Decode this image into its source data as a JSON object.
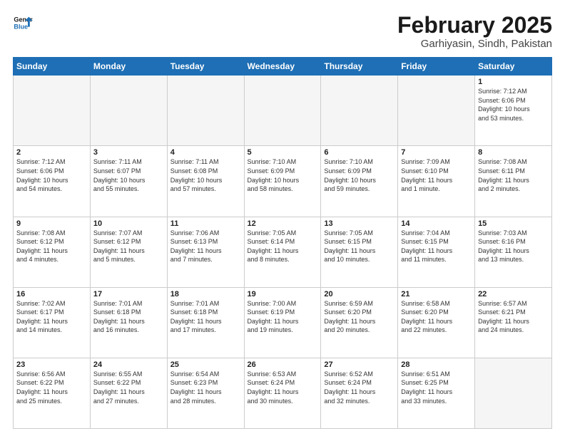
{
  "logo": {
    "line1": "General",
    "line2": "Blue"
  },
  "title": "February 2025",
  "subtitle": "Garhiyasin, Sindh, Pakistan",
  "weekdays": [
    "Sunday",
    "Monday",
    "Tuesday",
    "Wednesday",
    "Thursday",
    "Friday",
    "Saturday"
  ],
  "weeks": [
    [
      {
        "day": "",
        "info": ""
      },
      {
        "day": "",
        "info": ""
      },
      {
        "day": "",
        "info": ""
      },
      {
        "day": "",
        "info": ""
      },
      {
        "day": "",
        "info": ""
      },
      {
        "day": "",
        "info": ""
      },
      {
        "day": "1",
        "info": "Sunrise: 7:12 AM\nSunset: 6:06 PM\nDaylight: 10 hours\nand 53 minutes."
      }
    ],
    [
      {
        "day": "2",
        "info": "Sunrise: 7:12 AM\nSunset: 6:06 PM\nDaylight: 10 hours\nand 54 minutes."
      },
      {
        "day": "3",
        "info": "Sunrise: 7:11 AM\nSunset: 6:07 PM\nDaylight: 10 hours\nand 55 minutes."
      },
      {
        "day": "4",
        "info": "Sunrise: 7:11 AM\nSunset: 6:08 PM\nDaylight: 10 hours\nand 57 minutes."
      },
      {
        "day": "5",
        "info": "Sunrise: 7:10 AM\nSunset: 6:09 PM\nDaylight: 10 hours\nand 58 minutes."
      },
      {
        "day": "6",
        "info": "Sunrise: 7:10 AM\nSunset: 6:09 PM\nDaylight: 10 hours\nand 59 minutes."
      },
      {
        "day": "7",
        "info": "Sunrise: 7:09 AM\nSunset: 6:10 PM\nDaylight: 11 hours\nand 1 minute."
      },
      {
        "day": "8",
        "info": "Sunrise: 7:08 AM\nSunset: 6:11 PM\nDaylight: 11 hours\nand 2 minutes."
      }
    ],
    [
      {
        "day": "9",
        "info": "Sunrise: 7:08 AM\nSunset: 6:12 PM\nDaylight: 11 hours\nand 4 minutes."
      },
      {
        "day": "10",
        "info": "Sunrise: 7:07 AM\nSunset: 6:12 PM\nDaylight: 11 hours\nand 5 minutes."
      },
      {
        "day": "11",
        "info": "Sunrise: 7:06 AM\nSunset: 6:13 PM\nDaylight: 11 hours\nand 7 minutes."
      },
      {
        "day": "12",
        "info": "Sunrise: 7:05 AM\nSunset: 6:14 PM\nDaylight: 11 hours\nand 8 minutes."
      },
      {
        "day": "13",
        "info": "Sunrise: 7:05 AM\nSunset: 6:15 PM\nDaylight: 11 hours\nand 10 minutes."
      },
      {
        "day": "14",
        "info": "Sunrise: 7:04 AM\nSunset: 6:15 PM\nDaylight: 11 hours\nand 11 minutes."
      },
      {
        "day": "15",
        "info": "Sunrise: 7:03 AM\nSunset: 6:16 PM\nDaylight: 11 hours\nand 13 minutes."
      }
    ],
    [
      {
        "day": "16",
        "info": "Sunrise: 7:02 AM\nSunset: 6:17 PM\nDaylight: 11 hours\nand 14 minutes."
      },
      {
        "day": "17",
        "info": "Sunrise: 7:01 AM\nSunset: 6:18 PM\nDaylight: 11 hours\nand 16 minutes."
      },
      {
        "day": "18",
        "info": "Sunrise: 7:01 AM\nSunset: 6:18 PM\nDaylight: 11 hours\nand 17 minutes."
      },
      {
        "day": "19",
        "info": "Sunrise: 7:00 AM\nSunset: 6:19 PM\nDaylight: 11 hours\nand 19 minutes."
      },
      {
        "day": "20",
        "info": "Sunrise: 6:59 AM\nSunset: 6:20 PM\nDaylight: 11 hours\nand 20 minutes."
      },
      {
        "day": "21",
        "info": "Sunrise: 6:58 AM\nSunset: 6:20 PM\nDaylight: 11 hours\nand 22 minutes."
      },
      {
        "day": "22",
        "info": "Sunrise: 6:57 AM\nSunset: 6:21 PM\nDaylight: 11 hours\nand 24 minutes."
      }
    ],
    [
      {
        "day": "23",
        "info": "Sunrise: 6:56 AM\nSunset: 6:22 PM\nDaylight: 11 hours\nand 25 minutes."
      },
      {
        "day": "24",
        "info": "Sunrise: 6:55 AM\nSunset: 6:22 PM\nDaylight: 11 hours\nand 27 minutes."
      },
      {
        "day": "25",
        "info": "Sunrise: 6:54 AM\nSunset: 6:23 PM\nDaylight: 11 hours\nand 28 minutes."
      },
      {
        "day": "26",
        "info": "Sunrise: 6:53 AM\nSunset: 6:24 PM\nDaylight: 11 hours\nand 30 minutes."
      },
      {
        "day": "27",
        "info": "Sunrise: 6:52 AM\nSunset: 6:24 PM\nDaylight: 11 hours\nand 32 minutes."
      },
      {
        "day": "28",
        "info": "Sunrise: 6:51 AM\nSunset: 6:25 PM\nDaylight: 11 hours\nand 33 minutes."
      },
      {
        "day": "",
        "info": ""
      }
    ]
  ]
}
